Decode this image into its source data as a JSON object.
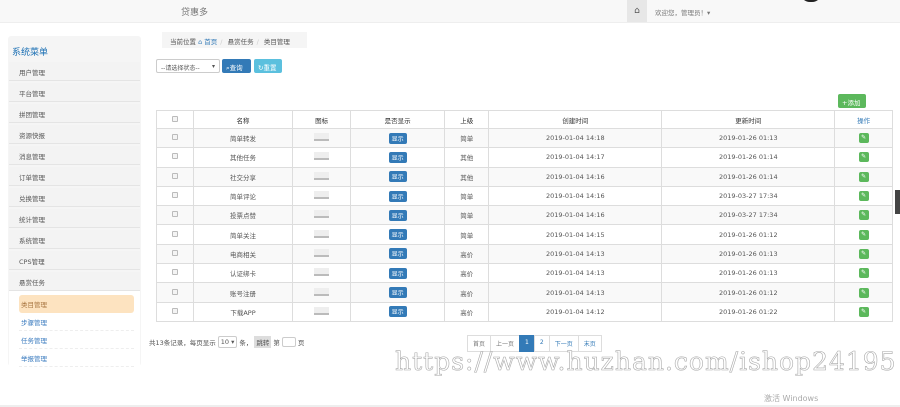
{
  "header": {
    "brand": "贷惠多",
    "welcome": "欢迎您，管理员！▾"
  },
  "sidebar": {
    "title": "系统菜单",
    "items": [
      "用户管理",
      "平台管理",
      "拼团管理",
      "资源快报",
      "消息管理",
      "订单管理",
      "兑换管理",
      "统计管理",
      "系统管理",
      "CPS管理",
      "悬赏任务"
    ],
    "sub_items": [
      "类目管理",
      "步骤管理",
      "任务管理",
      "举报管理"
    ]
  },
  "breadcrumb": {
    "label": "当前位置",
    "home": "首页",
    "level1": "悬赏任务",
    "level2": "类目管理"
  },
  "toolbar": {
    "filter_value": "--请选择状态--",
    "search": "查询",
    "reset": "重置",
    "add": "添加"
  },
  "table": {
    "headers": [
      "名称",
      "图标",
      "是否显示",
      "上级",
      "创建时间",
      "更新时间",
      "操作"
    ],
    "rows": [
      {
        "name": "简单转发",
        "show": "显示",
        "parent": "简单",
        "created": "2019-01-04 14:18",
        "updated": "2019-01-26 01:13"
      },
      {
        "name": "其他任务",
        "show": "显示",
        "parent": "其他",
        "created": "2019-01-04 14:17",
        "updated": "2019-01-26 01:14"
      },
      {
        "name": "社交分享",
        "show": "显示",
        "parent": "其他",
        "created": "2019-01-04 14:16",
        "updated": "2019-01-26 01:14"
      },
      {
        "name": "简单评论",
        "show": "显示",
        "parent": "简单",
        "created": "2019-01-04 14:16",
        "updated": "2019-03-27 17:34"
      },
      {
        "name": "投票点赞",
        "show": "显示",
        "parent": "简单",
        "created": "2019-01-04 14:16",
        "updated": "2019-03-27 17:34"
      },
      {
        "name": "简单关注",
        "show": "显示",
        "parent": "简单",
        "created": "2019-01-04 14:15",
        "updated": "2019-01-26 01:12"
      },
      {
        "name": "电商相关",
        "show": "显示",
        "parent": "高价",
        "created": "2019-01-04 14:13",
        "updated": "2019-01-26 01:13"
      },
      {
        "name": "认证绑卡",
        "show": "显示",
        "parent": "高价",
        "created": "2019-01-04 14:13",
        "updated": "2019-01-26 01:13"
      },
      {
        "name": "账号注册",
        "show": "显示",
        "parent": "高价",
        "created": "2019-01-04 14:13",
        "updated": "2019-01-26 01:12"
      },
      {
        "name": "下载APP",
        "show": "显示",
        "parent": "高价",
        "created": "2019-01-04 14:12",
        "updated": "2019-01-26 01:22"
      }
    ]
  },
  "footer": {
    "total": "共13条记录，每页显示",
    "page_size": "10 ▾",
    "unit": "条，",
    "jump": "跳转",
    "page_prefix": "第",
    "page_suffix": "页"
  },
  "pagination": {
    "first": "首页",
    "prev": "上一页",
    "pages": [
      "1",
      "2"
    ],
    "next": "下一页",
    "last": "末页"
  },
  "overlay": {
    "watermark": "https://www.huzhan.com/ishop24195",
    "activate": "激活 Windows"
  }
}
